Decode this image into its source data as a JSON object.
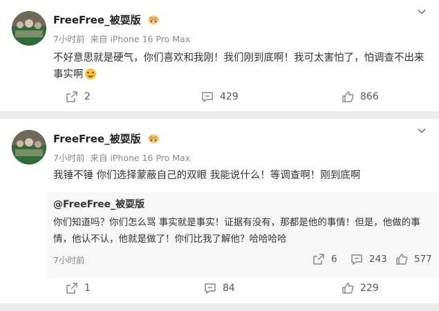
{
  "posts": [
    {
      "username": "FreeFree_被耍版",
      "time": "7小时前",
      "source": "来自 iPhone 16 Pro Max",
      "content": "不好意思就是硬气，你们喜欢和我刚！我们刚到底啊！我可太害怕了，怕调查不出来事实啊",
      "reposts": "2",
      "comments": "429",
      "likes": "866"
    },
    {
      "username": "FreeFree_被耍版",
      "time": "7小时前",
      "source": "来自 iPhone 16 Pro Max",
      "content": "我锤不锤 你们选择蒙蔽自己的双眼 我能说什么！等调查啊！刚到底啊",
      "quote": {
        "user": "@FreeFree_被耍版",
        "text": "你们知道吗？你们怎么骂 事实就是事实！证据有没有，那都是他的事情！但是，他做的事情，他认不认，他就是做了！你们比我了解他？哈哈哈哈",
        "time": "7小时前",
        "reposts": "6",
        "comments": "243",
        "likes": "577"
      },
      "reposts": "1",
      "comments": "84",
      "likes": "229"
    }
  ],
  "icons": {
    "chevron": "chevron-down-icon",
    "repost": "repost-icon",
    "comment": "comment-icon",
    "like": "thumbs-up-icon",
    "crown": "crown-badge-icon",
    "emoji": "emoji-icon"
  },
  "colors": {
    "username": "#222222",
    "meta": "#8a8a8a",
    "divider": "#ececec",
    "quote_bg": "#f7f7f7"
  }
}
